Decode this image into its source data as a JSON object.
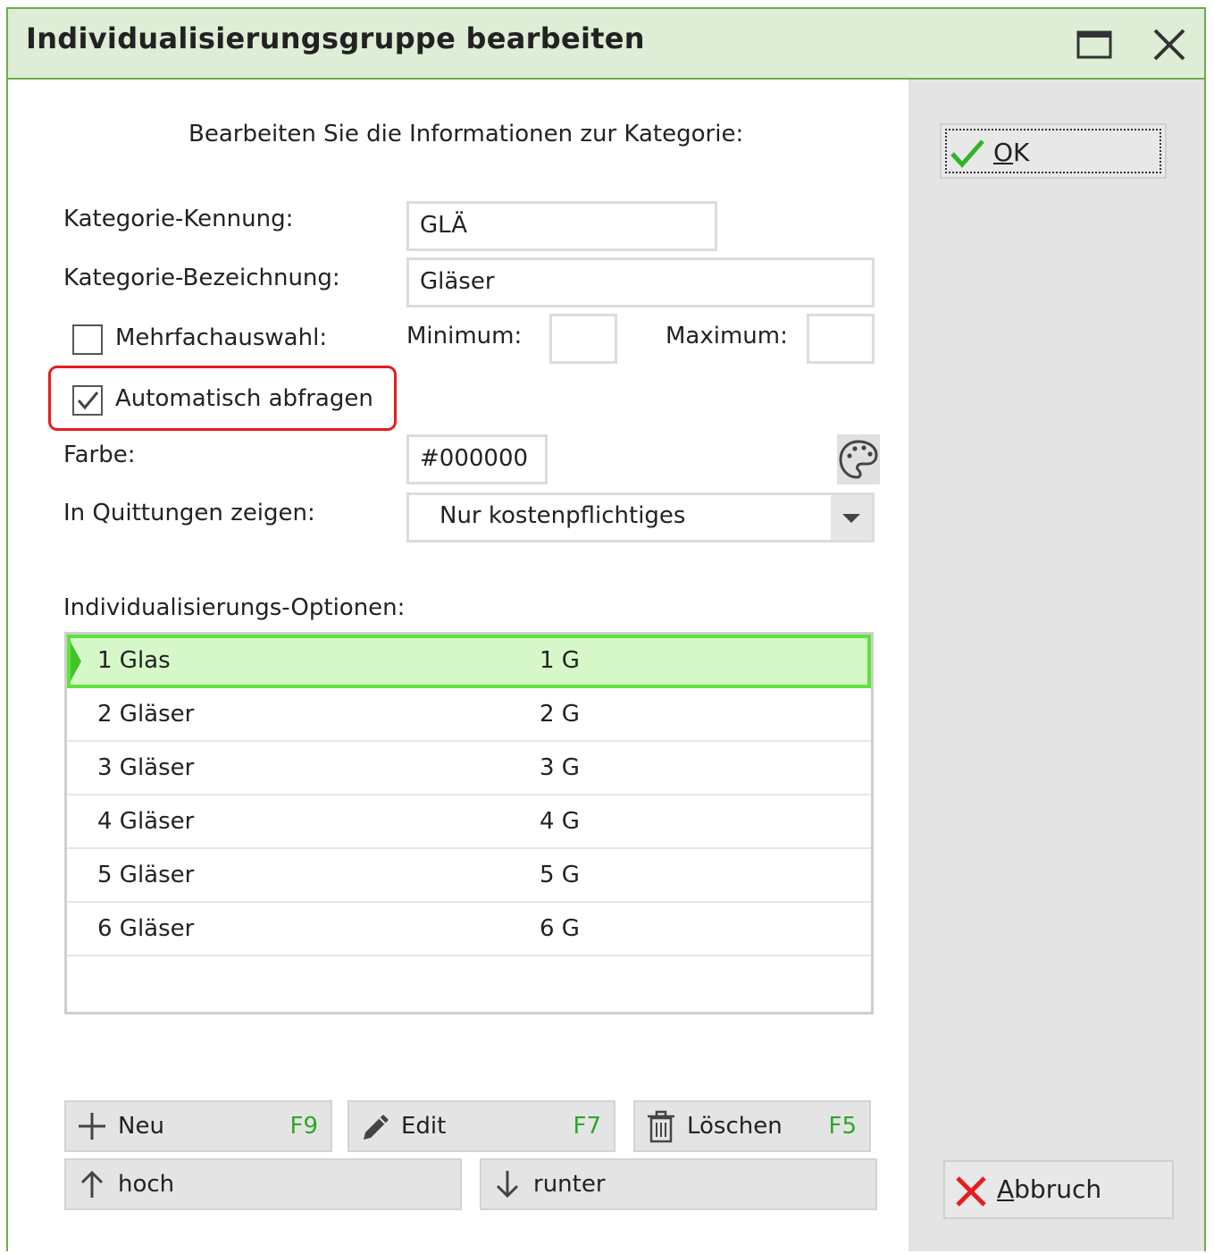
{
  "window": {
    "title": "Individualisierungsgruppe bearbeiten"
  },
  "form": {
    "intro": "Bearbeiten Sie die Informationen zur Kategorie:",
    "kennung_label": "Kategorie-Kennung:",
    "kennung_value": "GLÄ",
    "bezeichnung_label": "Kategorie-Bezeichnung:",
    "bezeichnung_value": "Gläser",
    "mehrfach_label": "Mehrfachauswahl:",
    "mehrfach_checked": false,
    "minimum_label": "Minimum:",
    "minimum_value": "",
    "maximum_label": "Maximum:",
    "maximum_value": "",
    "auto_label": "Automatisch abfragen",
    "auto_checked": true,
    "farbe_label": "Farbe:",
    "farbe_value": "#000000",
    "quittung_label": "In Quittungen zeigen:",
    "quittung_value": "Nur kostenpflichtiges",
    "options_label": "Individualisierungs-Optionen:"
  },
  "options": [
    {
      "name": "1 Glas",
      "code": "1 G",
      "selected": true
    },
    {
      "name": "2 Gläser",
      "code": "2 G",
      "selected": false
    },
    {
      "name": "3 Gläser",
      "code": "3 G",
      "selected": false
    },
    {
      "name": "4 Gläser",
      "code": "4 G",
      "selected": false
    },
    {
      "name": "5 Gläser",
      "code": "5 G",
      "selected": false
    },
    {
      "name": "6 Gläser",
      "code": "6 G",
      "selected": false
    }
  ],
  "buttons": {
    "neu": {
      "label": "Neu",
      "key": "F9"
    },
    "edit": {
      "label": "Edit",
      "key": "F7"
    },
    "loeschen": {
      "label": "Löschen",
      "key": "F5"
    },
    "hoch": {
      "label": "hoch"
    },
    "runter": {
      "label": "runter"
    }
  },
  "side": {
    "ok_mnemonic": "O",
    "ok_rest": "K",
    "abbruch_mnemonic": "A",
    "abbruch_rest": "bbruch"
  },
  "colors": {
    "accent_green": "#6aae4c",
    "selection_fill": "#d6f8c8",
    "selection_border": "#5fe23a",
    "highlight_red": "#e41e1e",
    "shortcut_green": "#2ba82b"
  }
}
